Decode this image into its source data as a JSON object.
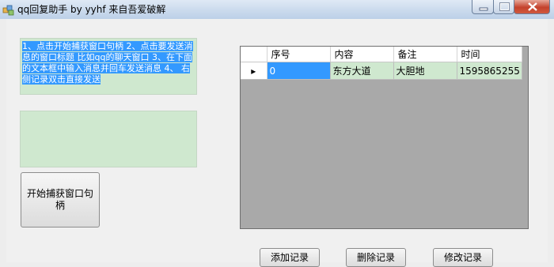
{
  "window": {
    "title": "qq回复助手 by yyhf 来自吾爱破解",
    "icon": "app-icon",
    "controls": [
      "minimize-icon",
      "maximize-icon",
      "close-icon"
    ]
  },
  "left_panel": {
    "instructions_text": "1、点击开始捕获窗口句柄 2、点击要发送消息的窗口标题 比如qq的聊天窗口 3、在下面的文本框中输入消息并回车发送消息 4、 右侧记录双击直接发送",
    "message_input_value": "",
    "capture_button_label": "开始捕获窗口句柄"
  },
  "grid": {
    "columns": [
      "序号",
      "内容",
      "备注",
      "时间"
    ],
    "rows": [
      {
        "cells": [
          "0",
          "东方大道",
          "大胆地",
          "1595865255"
        ],
        "selected": true
      }
    ],
    "row_indicator": "▸"
  },
  "buttons": {
    "add": "添加记录",
    "delete": "删除记录",
    "edit": "修改记录"
  },
  "colors": {
    "textbox_bg": "#cfe8cf",
    "selection": "#3399ff",
    "grid_bg": "#a9a9a9"
  }
}
